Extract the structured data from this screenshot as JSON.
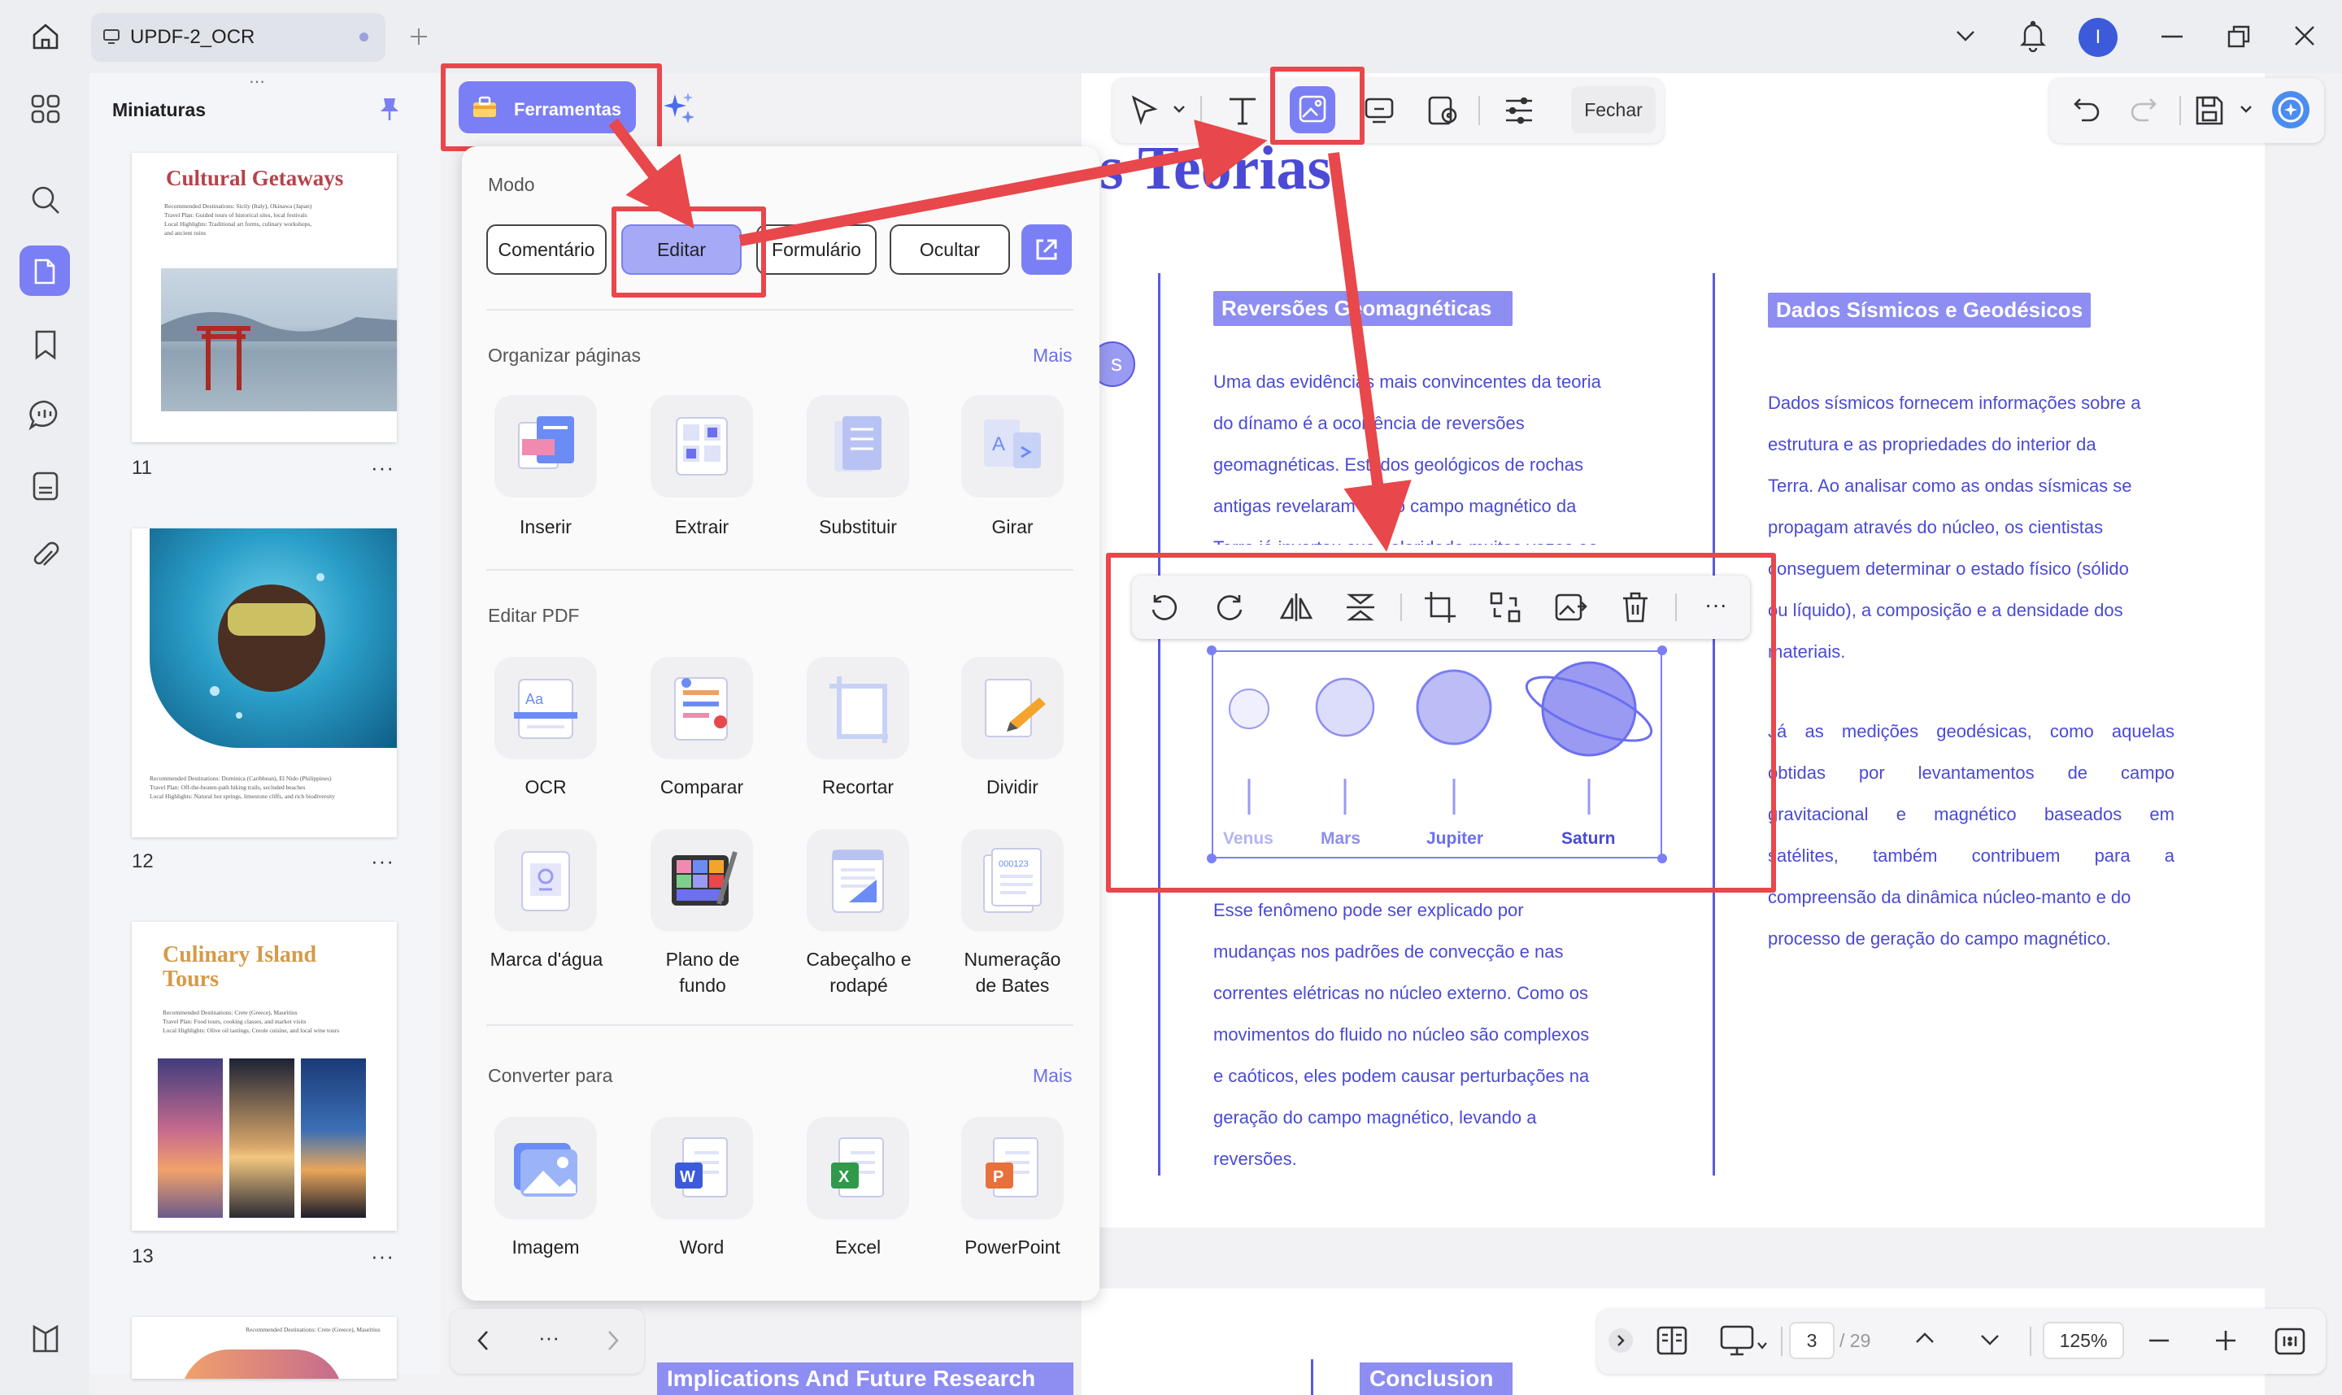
{
  "app": {
    "tab_title": "UPDF-2_OCR",
    "avatar_initial": "I",
    "accent": "#7b7ff5",
    "annotation_color": "#e8474b"
  },
  "thumbnails": {
    "title": "Miniaturas",
    "more": "···",
    "pages": [
      {
        "number": "11",
        "heading": "Cultural Getaways",
        "lines": [
          "Recommended Destinations: Sicily (Italy), Okinawa (Japan)",
          "Travel Plan: Guided tours of historical sites, local festivals",
          "Local Highlights: Traditional art forms, culinary workshops,",
          "and ancient ruins"
        ]
      },
      {
        "number": "12",
        "lines": [
          "Recommended Destinations: Dominica (Caribbean), El Nido (Philippines)",
          "Travel Plan: Off-the-beaten-path hiking trails, secluded beaches",
          "Local Highlights: Natural hot springs, limestone cliffs, and rich biodiversity"
        ]
      },
      {
        "number": "13",
        "heading": "Culinary Island Tours",
        "lines": [
          "Recommended Destinations: Crete (Greece), Mauritius",
          "Travel Plan: Food tours, cooking classes, and market visits",
          "Local Highlights: Olive oil tastings, Creole cuisine, and local wine tours"
        ]
      },
      {
        "number": "",
        "lines": [
          "Recommended Destinations: Crete (Greece), Mauritius"
        ]
      }
    ]
  },
  "tools_menu": {
    "button_label": "Ferramentas",
    "mode_label": "Modo",
    "modes": [
      "Comentário",
      "Editar",
      "Formulário",
      "Ocultar"
    ],
    "organize_label": "Organizar páginas",
    "organize_more": "Mais",
    "organize_items": [
      "Inserir",
      "Extrair",
      "Substituir",
      "Girar"
    ],
    "edit_label": "Editar PDF",
    "edit_items": [
      "OCR",
      "Comparar",
      "Recortar",
      "Dividir",
      "Marca d'água",
      "Plano de fundo",
      "Cabeçalho e rodapé",
      "Numeração de Bates"
    ],
    "convert_label": "Converter para",
    "convert_more": "Mais",
    "convert_items": [
      "Imagem",
      "Word",
      "Excel",
      "PowerPoint"
    ]
  },
  "edit_toolbar": {
    "close_label": "Fechar"
  },
  "document": {
    "title_partial": "s Teorias",
    "col1_heading": "Reversões Geomagnéticas",
    "col1_para1": [
      "Uma das evidências mais convincentes da teoria",
      "do dínamo é a ocorrência de reversões",
      "geomagnéticas. Estudos geológicos de rochas",
      "antigas revelaram que o campo magnético da",
      "Terra já inverteu sua polaridade muitas vezes ao"
    ],
    "col1_para2": [
      "Esse fenômeno pode ser explicado por",
      "mudanças nos padrões de convecção e nas",
      "correntes elétricas no núcleo externo. Como os",
      "movimentos do fluido no núcleo são complexos",
      "e caóticos, eles podem causar perturbações na",
      "geração do campo magnético, levando a",
      "reversões."
    ],
    "col2_heading": "Dados Sísmicos e Geodésicos",
    "col2_para1": [
      "Dados sísmicos fornecem informações sobre a",
      "estrutura e as propriedades do interior da",
      "Terra. Ao analisar como as ondas sísmicas se",
      "propagam através do núcleo, os cientistas",
      "conseguem determinar o estado físico (sólido",
      "ou líquido), a composição e a densidade dos",
      "materiais."
    ],
    "col2_para2": [
      "Já as medições geodésicas, como aquelas",
      "obtidas por levantamentos de campo",
      "gravitacional e magnético baseados em",
      "satélites, também contribuem para a",
      "compreensão da dinâmica núcleo-manto e do",
      "processo de geração do campo magnético."
    ],
    "planets": [
      "Venus",
      "Mars",
      "Jupiter",
      "Saturn"
    ],
    "left_circle": "s",
    "next_heading_1": "Implications And Future Research",
    "next_heading_2": "Conclusion"
  },
  "bottom_bar": {
    "page_current": "3",
    "page_total": "/ 29",
    "zoom": "125%",
    "nav_more": "···"
  }
}
